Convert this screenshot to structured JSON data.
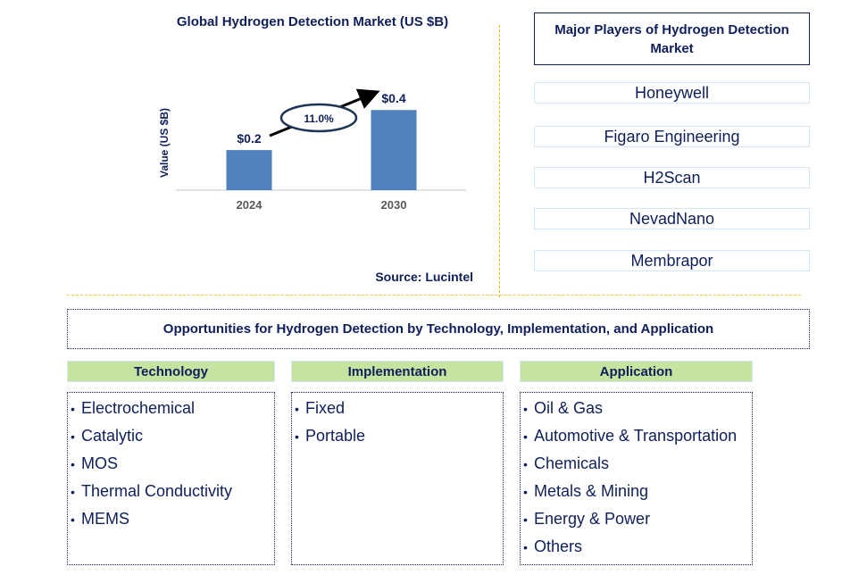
{
  "chart_data": {
    "type": "bar",
    "title": "Global Hydrogen Detection Market (US $B)",
    "xlabel": "",
    "ylabel": "Value (US $B)",
    "categories": [
      "2024",
      "2030"
    ],
    "values": [
      0.2,
      0.4
    ],
    "data_labels": [
      "$0.2",
      "$0.4"
    ],
    "ylim": [
      0,
      0.45
    ],
    "grid": false,
    "bar_color": "#4f81bd",
    "annotation": {
      "type": "cagr-arrow",
      "text": "11.0%",
      "from": "2024",
      "to": "2030"
    },
    "source": "Source: Lucintel"
  },
  "players": {
    "title": "Major Players of Hydrogen Detection Market",
    "items": [
      "Honeywell",
      "Figaro Engineering",
      "H2Scan",
      "NevadNano",
      "Membrapor"
    ]
  },
  "opportunities": {
    "title": "Opportunities for Hydrogen Detection by Technology, Implementation, and Application",
    "categories": [
      {
        "label": "Technology",
        "items": [
          "Electrochemical",
          "Catalytic",
          "MOS",
          "Thermal Conductivity",
          "MEMS"
        ]
      },
      {
        "label": "Implementation",
        "items": [
          "Fixed",
          "Portable"
        ]
      },
      {
        "label": "Application",
        "items": [
          "Oil & Gas",
          "Automotive & Transportation",
          "Chemicals",
          "Metals & Mining",
          "Energy & Power",
          "Others"
        ]
      }
    ]
  },
  "colors": {
    "navy_text": "#0e1f5b",
    "bar": "#4f81bd",
    "category_header_bg": "#c6e4a0",
    "divider_gold": "#f5b400",
    "player_border": "#d6e6f4"
  }
}
